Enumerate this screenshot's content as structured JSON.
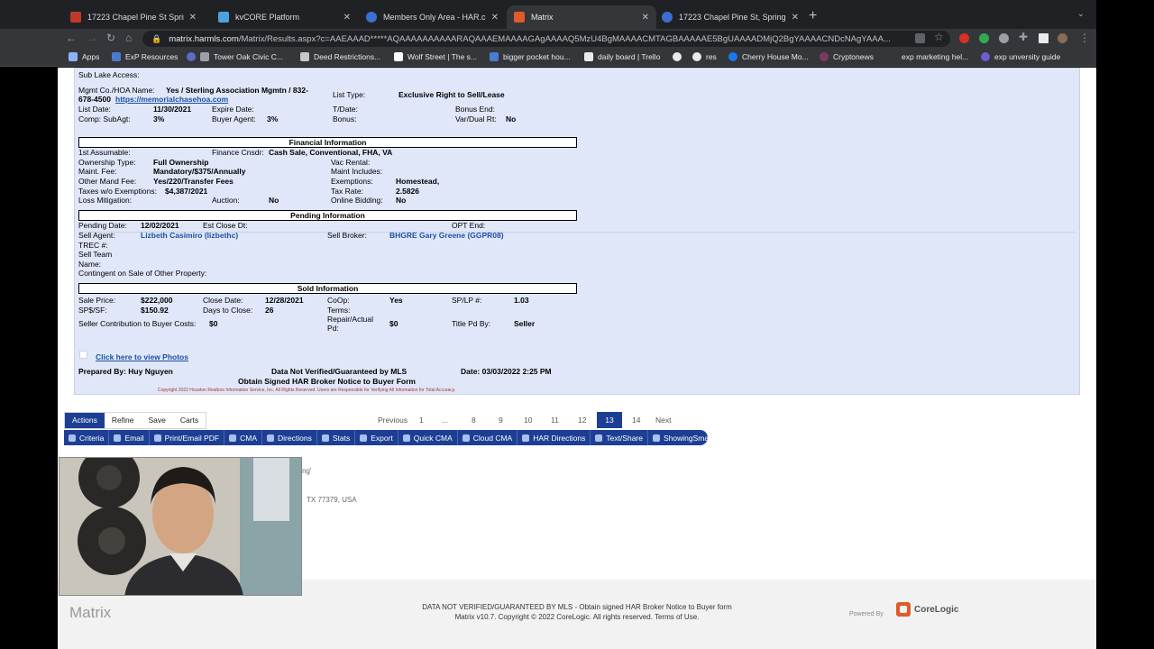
{
  "browser": {
    "tabs": [
      {
        "title": "17223 Chapel Pine St Spring, T",
        "active": false
      },
      {
        "title": "kvCORE Platform",
        "active": false
      },
      {
        "title": "Members Only Area - HAR.com",
        "active": false
      },
      {
        "title": "Matrix",
        "active": true
      },
      {
        "title": "17223 Chapel Pine St, Spring,",
        "active": false
      }
    ],
    "url_host": "matrix.harmls.com",
    "url_path": "/Matrix/Results.aspx?c=AAEAAAD*****AQAAAAAAAAAARAQAAAEMAAAAGAgAAAAQ5MzU4BgMAAAACMTAGBAAAAAE5BgUAAAADMjQ2BgYAAAACNDcNAgYAAA...",
    "bookmarks": [
      "Apps",
      "ExP Resources",
      "Tower Oak Civic C...",
      "Deed Restrictions...",
      "Wolf Street | The s...",
      "bigger pocket hou...",
      "daily board | Trello",
      "res",
      "Cherry House Mo...",
      "Cryptonews",
      "exp marketing hel...",
      "exp unversity guide"
    ]
  },
  "report": {
    "sub_lake_access": "Sub Lake Access:",
    "mgmt_label": "Mgmt Co./HOA Name:",
    "mgmt_value": "Yes / Sterling Association Mgmtn / 832-",
    "mgmt_value2": "678-4500",
    "mgmt_link": "https://memorialchasehoa.com",
    "list_type_label": "List Type:",
    "list_type_value": "Exclusive Right to Sell/Lease",
    "list_date_label": "List Date:",
    "list_date_value": "11/30/2021",
    "expire_label": "Expire Date:",
    "tdate_label": "T/Date:",
    "bonus_end_label": "Bonus End:",
    "comp_label": "Comp: SubAgt:",
    "comp_value": "3%",
    "buyer_agent_label": "Buyer Agent:",
    "buyer_agent_value": "3%",
    "bonus_label": "Bonus:",
    "vardual_label": "Var/Dual Rt:",
    "vardual_value": "No",
    "financial_header": "Financial Information",
    "first_assumable": "1st Assumable:",
    "finance_label": "Finance Cnsdr:",
    "finance_value": "Cash Sale, Conventional, FHA, VA",
    "ownership_label": "Ownership Type:",
    "ownership_value": "Full Ownership",
    "vac_rental": "Vac Rental:",
    "maint_fee_label": "Maint. Fee:",
    "maint_fee_value": "Mandatory/$375/Annually",
    "maint_includes": "Maint Includes:",
    "other_mand_label": "Other Mand Fee:",
    "other_mand_value": "Yes/220/Transfer Fees",
    "exemptions_label": "Exemptions:",
    "exemptions_value": "Homestead,",
    "taxes_label": "Taxes w/o Exemptions:",
    "taxes_value": "$4,387/2021",
    "tax_rate_label": "Tax Rate:",
    "tax_rate_value": "2.5826",
    "loss_mit": "Loss Mitigation:",
    "auction_label": "Auction:",
    "auction_value": "No",
    "online_bid_label": "Online Bidding:",
    "online_bid_value": "No",
    "pending_header": "Pending Information",
    "pending_date_label": "Pending Date:",
    "pending_date_value": "12/02/2021",
    "est_close": "Est Close Dt:",
    "opt_end": "OPT End:",
    "sell_agent_label": "Sell Agent:",
    "sell_agent_value": "Lizbeth Casimiro (lizbethc)",
    "sell_broker_label": "Sell Broker:",
    "sell_broker_value": "BHGRE Gary Greene (GGPR08)",
    "trec": "TREC #:",
    "sell_team": "Sell Team",
    "name": "Name:",
    "contingent": "Contingent on Sale of Other Property:",
    "sold_header": "Sold Information",
    "sale_price_label": "Sale Price:",
    "sale_price_value": "$222,000",
    "close_date_label": "Close Date:",
    "close_date_value": "12/28/2021",
    "coop_label": "CoOp:",
    "coop_value": "Yes",
    "splp_label": "SP/LP #:",
    "splp_value": "1.03",
    "spsf_label": "SP$/SF:",
    "spsf_value": "$150.92",
    "dtc_label": "Days to Close:",
    "dtc_value": "26",
    "terms": "Terms:",
    "seller_contrib_label": "Seller Contribution to Buyer Costs:",
    "seller_contrib_value": "$0",
    "repair_label1": "Repair/Actual",
    "repair_label2": "Pd:",
    "repair_value": "$0",
    "title_pd_label": "Title Pd By:",
    "title_pd_value": "Seller",
    "photos_link": "Click here to view Photos",
    "prepared": "Prepared By: Huy Nguyen",
    "not_verified": "Data Not Verified/Guaranteed by MLS",
    "date": "Date: 03/03/2022 2:25 PM",
    "obtain": "Obtain Signed HAR Broker Notice to Buyer Form",
    "copyright": "Copyright 2022 Houston Realtors Information Service, Inc. All Rights Reserved. Users are Responsible for Verifying All Information for Total Accuracy."
  },
  "actions": {
    "tabs": [
      "Actions",
      "Refine",
      "Save",
      "Carts"
    ],
    "pager": {
      "previous": "Previous",
      "pages": [
        "1",
        "...",
        "8",
        "9",
        "10",
        "11",
        "12",
        "13",
        "14"
      ],
      "current": "13",
      "next": "Next"
    },
    "buttons": [
      "Criteria",
      "Email",
      "Print/Email PDF",
      "CMA",
      "Directions",
      "Stats",
      "Export",
      "Quick CMA",
      "Cloud CMA",
      "HAR Directions",
      "Text/Share",
      "ShowingSmart"
    ]
  },
  "behind": {
    "frag1": "ng'",
    "frag2": "TX 77379, USA"
  },
  "footer": {
    "logo": "Matrix",
    "line1": "DATA NOT VERIFIED/GUARANTEED BY MLS - Obtain signed HAR Broker Notice to Buyer form",
    "line2": "Matrix v10.7. Copyright © 2022 CoreLogic. All rights reserved. Terms of Use.",
    "powered_by": "Powered By",
    "corelogic": "CoreLogic"
  }
}
